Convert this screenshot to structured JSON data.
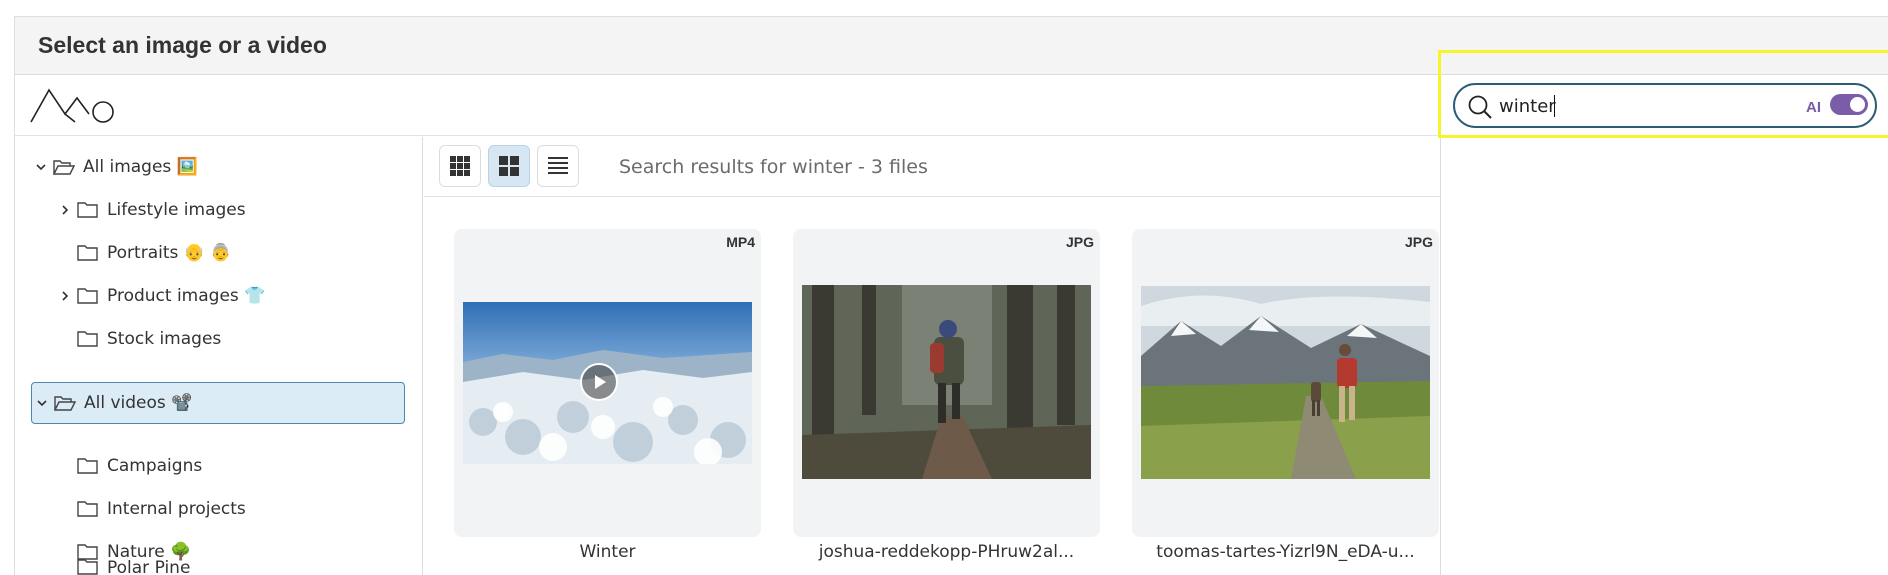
{
  "dialog": {
    "title": "Select an image or a video"
  },
  "search": {
    "value": "winter",
    "ai_label": "AI",
    "ai_enabled": true
  },
  "sidebar": {
    "items": [
      {
        "label": "All images 🖼️",
        "expanded": true,
        "selected": false
      },
      {
        "label": "Lifestyle images",
        "expanded": false,
        "selected": false
      },
      {
        "label": "Portraits 👴 👵",
        "expanded": false,
        "selected": false
      },
      {
        "label": "Product images 👕",
        "expanded": false,
        "selected": false
      },
      {
        "label": "Stock images",
        "expanded": false,
        "selected": false
      },
      {
        "label": "All videos 📽️",
        "expanded": true,
        "selected": true
      },
      {
        "label": "Campaigns",
        "expanded": false,
        "selected": false
      },
      {
        "label": "Internal projects",
        "expanded": false,
        "selected": false
      },
      {
        "label": "Nature 🌳",
        "expanded": false,
        "selected": false
      },
      {
        "label": "Polar Pine",
        "expanded": false,
        "selected": false
      }
    ]
  },
  "main": {
    "results_text": "Search results for winter - 3 files",
    "files": [
      {
        "type": "MP4",
        "name": "Winter"
      },
      {
        "type": "JPG",
        "name": "joshua-reddekopp-PHruw2al..."
      },
      {
        "type": "JPG",
        "name": "toomas-tartes-Yizrl9N_eDA-u..."
      }
    ]
  },
  "colors": {
    "accent": "#7b5ca8",
    "selection_bg": "#dcecf7",
    "search_border": "#2d5d74",
    "highlight": "#f5f52a"
  }
}
